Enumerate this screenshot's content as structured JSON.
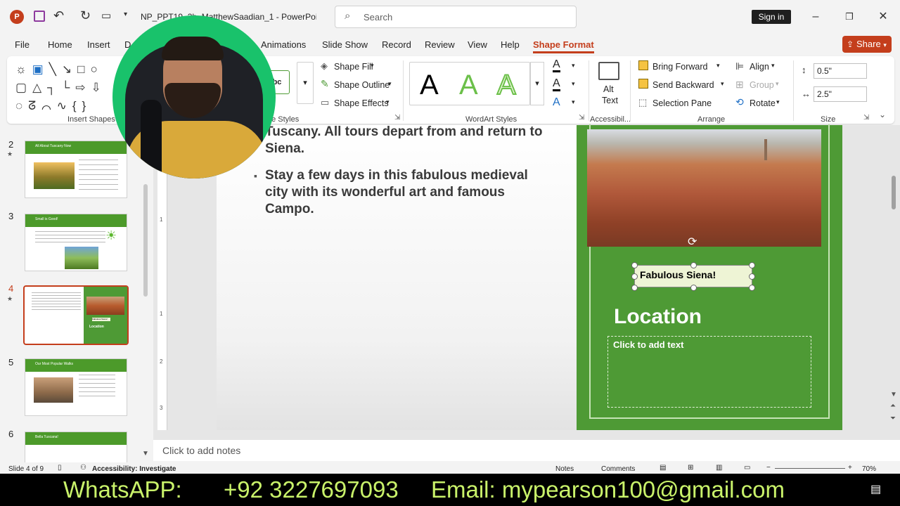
{
  "titlebar": {
    "filename": "NP_PPT19_3b_MatthewSaadian_1 - PowerPoi...",
    "search_placeholder": "Search",
    "signin": "Sign in"
  },
  "menu": {
    "items": [
      "File",
      "Home",
      "Insert",
      "D",
      "Animations",
      "Slide Show",
      "Record",
      "Review",
      "View",
      "Help",
      "Shape Format"
    ],
    "share": "Share"
  },
  "ribbon": {
    "insert_shapes": "Insert Shapes",
    "shape_styles": "pe Styles",
    "shape_fill": "Shape Fill",
    "shape_outline": "Shape Outline",
    "shape_effects": "Shape Effects",
    "wordart_styles": "WordArt Styles",
    "wordart_letter": "A",
    "alt_text_line1": "Alt",
    "alt_text_line2": "Text",
    "accessibility": "Accessibil...",
    "bring_forward": "Bring Forward",
    "send_backward": "Send Backward",
    "selection_pane": "Selection Pane",
    "align": "Align",
    "group": "Group",
    "rotate": "Rotate",
    "arrange": "Arrange",
    "height": "0.5\"",
    "width": "2.5\"",
    "size": "Size",
    "abc": "bc"
  },
  "thumbnails": [
    {
      "num": "2",
      "title": "All About Tuscany Now"
    },
    {
      "num": "3",
      "title": "Small is Good!"
    },
    {
      "num": "4",
      "title": "",
      "caption": "Fabulous Siena!",
      "location": "Location"
    },
    {
      "num": "5",
      "title": "Our Most Popular Walks"
    },
    {
      "num": "6",
      "title": "Bella Tuscana!"
    }
  ],
  "slide": {
    "bullet1": "Tuscany. All tours depart from and return to Siena.",
    "bullet2": "Stay a few days in this fabulous medieval city with its wonderful art and famous Campo.",
    "caption": "Fabulous Siena!",
    "location": "Location",
    "placeholder": "Click to add text"
  },
  "notes": "Click to add notes",
  "status": {
    "slide": "Slide 4 of 9",
    "accessibility": "Accessibility: Investigate",
    "notes": "Notes",
    "comments": "Comments",
    "zoom": "70%"
  },
  "banner": {
    "whatsapp_label": "WhatsAPP:",
    "phone": "+92 3227697093",
    "email": "Email: mypearson100@gmail.com"
  },
  "colors": {
    "accent": "#c43e1c",
    "slide_green": "#4e9a35",
    "banner_text": "#c9f26a"
  }
}
